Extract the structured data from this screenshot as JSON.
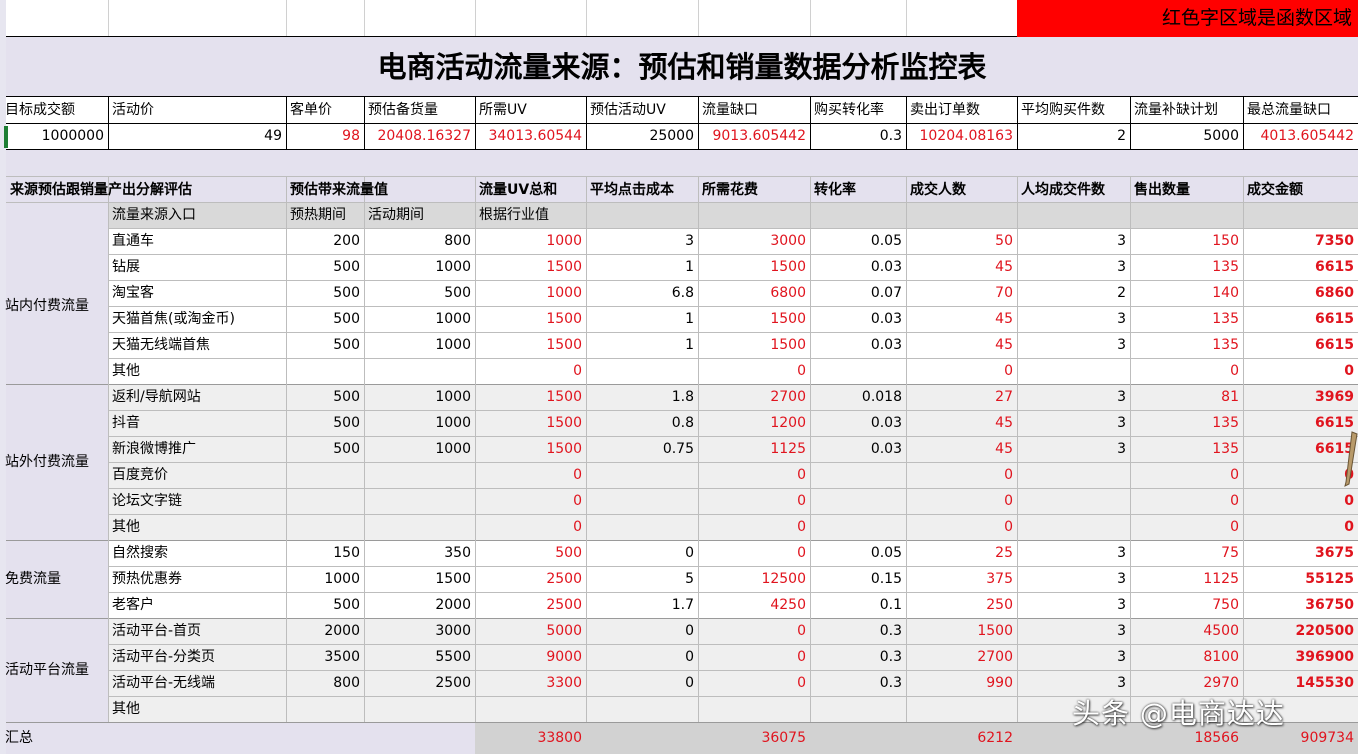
{
  "notice": "红色字区域是函数区域",
  "title": "电商活动流量来源：预估和销量数据分析监控表",
  "top_headers": [
    "目标成交额",
    "活动价",
    "客单价",
    "预估备货量",
    "所需UV",
    "预估活动UV",
    "流量缺口",
    "购买转化率",
    "卖出订单数",
    "平均购买件数",
    "流量补缺计划",
    "最总流量缺口"
  ],
  "top_values": [
    "1000000",
    "49",
    "98",
    "20408.16327",
    "34013.60544",
    "25000",
    "9013.605442",
    "0.3",
    "10204.08163",
    "2",
    "5000",
    "4013.605442"
  ],
  "section_header": [
    "来源预估跟销量产出分解评估",
    "预估带来流量值",
    "流量UV总和",
    "平均点击成本",
    "所需花费",
    "转化率",
    "成交人数",
    "人均成交件数",
    "售出数量",
    "成交金额"
  ],
  "sub_header": [
    "流量来源入口",
    "预热期间",
    "活动期间",
    "根据行业值"
  ],
  "groups": [
    "站内付费流量",
    "站外付费流量",
    "免费流量",
    "活动平台流量"
  ],
  "rows": [
    [
      "直通车",
      "200",
      "800",
      "1000",
      "3",
      "3000",
      "0.05",
      "50",
      "3",
      "150",
      "7350"
    ],
    [
      "钻展",
      "500",
      "1000",
      "1500",
      "1",
      "1500",
      "0.03",
      "45",
      "3",
      "135",
      "6615"
    ],
    [
      "淘宝客",
      "500",
      "500",
      "1000",
      "6.8",
      "6800",
      "0.07",
      "70",
      "2",
      "140",
      "6860"
    ],
    [
      "天猫首焦(或淘金币)",
      "500",
      "1000",
      "1500",
      "1",
      "1500",
      "0.03",
      "45",
      "3",
      "135",
      "6615"
    ],
    [
      "天猫无线端首焦",
      "500",
      "1000",
      "1500",
      "1",
      "1500",
      "0.03",
      "45",
      "3",
      "135",
      "6615"
    ],
    [
      "其他",
      "",
      "",
      "0",
      "",
      "0",
      "",
      "0",
      "",
      "0",
      "0"
    ],
    [
      "返利/导航网站",
      "500",
      "1000",
      "1500",
      "1.8",
      "2700",
      "0.018",
      "27",
      "3",
      "81",
      "3969"
    ],
    [
      "抖音",
      "500",
      "1000",
      "1500",
      "0.8",
      "1200",
      "0.03",
      "45",
      "3",
      "135",
      "6615"
    ],
    [
      "新浪微博推广",
      "500",
      "1000",
      "1500",
      "0.75",
      "1125",
      "0.03",
      "45",
      "3",
      "135",
      "6615"
    ],
    [
      "百度竞价",
      "",
      "",
      "0",
      "",
      "0",
      "",
      "0",
      "",
      "0",
      "0"
    ],
    [
      "论坛文字链",
      "",
      "",
      "0",
      "",
      "0",
      "",
      "0",
      "",
      "0",
      "0"
    ],
    [
      "其他",
      "",
      "",
      "0",
      "",
      "0",
      "",
      "0",
      "",
      "0",
      "0"
    ],
    [
      "自然搜索",
      "150",
      "350",
      "500",
      "0",
      "0",
      "0.05",
      "25",
      "3",
      "75",
      "3675"
    ],
    [
      "预热优惠券",
      "1000",
      "1500",
      "2500",
      "5",
      "12500",
      "0.15",
      "375",
      "3",
      "1125",
      "55125"
    ],
    [
      "老客户",
      "500",
      "2000",
      "2500",
      "1.7",
      "4250",
      "0.1",
      "250",
      "3",
      "750",
      "36750"
    ],
    [
      "活动平台-首页",
      "2000",
      "3000",
      "5000",
      "0",
      "0",
      "0.3",
      "1500",
      "3",
      "4500",
      "220500"
    ],
    [
      "活动平台-分类页",
      "3500",
      "5500",
      "9000",
      "0",
      "0",
      "0.3",
      "2700",
      "3",
      "8100",
      "396900"
    ],
    [
      "活动平台-无线端",
      "800",
      "2500",
      "3300",
      "0",
      "0",
      "0.3",
      "990",
      "3",
      "2970",
      "145530"
    ],
    [
      "其他",
      "",
      "",
      "",
      "",
      "",
      "",
      "",
      "",
      "",
      ""
    ]
  ],
  "total": {
    "label": "汇总",
    "uv": "33800",
    "cost": "36075",
    "buyers": "6212",
    "qty": "18566",
    "amount": "909734"
  },
  "watermark": "头条 @电商达达"
}
